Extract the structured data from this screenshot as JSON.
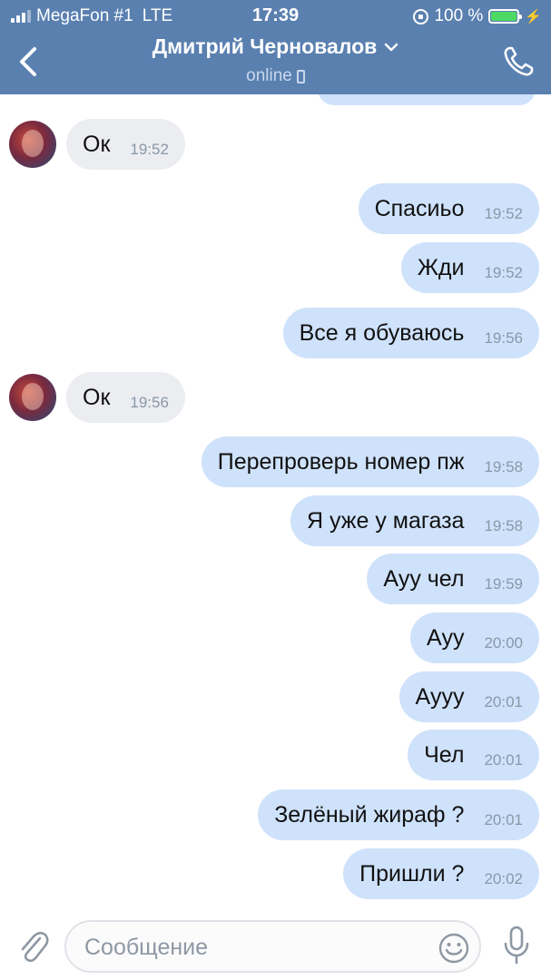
{
  "status_bar": {
    "carrier": "MegaFon #1",
    "network": "LTE",
    "time": "17:39",
    "battery": "100 %",
    "battery_level": 1.0
  },
  "header": {
    "contact_name": "Дмитрий Черновалов",
    "status": "online",
    "accent_color": "#5a80b0"
  },
  "messages": [
    {
      "dir": "in",
      "text": "Ок",
      "time": "19:52"
    },
    {
      "dir": "out",
      "text": "Спасиьо",
      "time": "19:52"
    },
    {
      "dir": "out",
      "text": "Жди",
      "time": "19:52"
    },
    {
      "dir": "out",
      "text": "Все я обуваюсь",
      "time": "19:56"
    },
    {
      "dir": "in",
      "text": "Ок",
      "time": "19:56"
    },
    {
      "dir": "out",
      "text": "Перепроверь номер пж",
      "time": "19:58"
    },
    {
      "dir": "out",
      "text": "Я уже у магаза",
      "time": "19:58"
    },
    {
      "dir": "out",
      "text": "Ауу чел",
      "time": "19:59"
    },
    {
      "dir": "out",
      "text": "Ауу",
      "time": "20:00"
    },
    {
      "dir": "out",
      "text": "Аууу",
      "time": "20:01"
    },
    {
      "dir": "out",
      "text": "Чел",
      "time": "20:01"
    },
    {
      "dir": "out",
      "text": "Зелёный жираф ?",
      "time": "20:01"
    },
    {
      "dir": "out",
      "text": "Пришли ?",
      "time": "20:02"
    }
  ],
  "composer": {
    "placeholder": "Сообщение"
  },
  "colors": {
    "outgoing_bubble": "#cfe2fb",
    "incoming_bubble": "#ecedf1"
  }
}
